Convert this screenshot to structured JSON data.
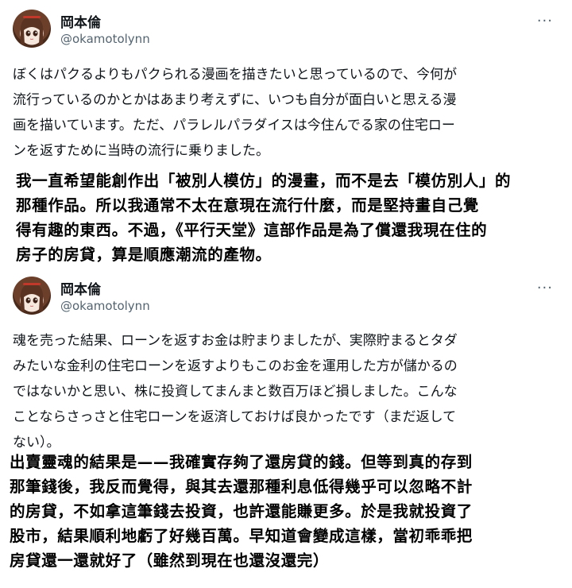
{
  "posts": [
    {
      "author": {
        "name": "岡本倫",
        "handle": "@okamotolynn"
      },
      "more_icon": "more-dots-icon",
      "text": "ぼくはパクるよりもパクられる漫画を描きたいと思っているので、今何が\n流行っているのかとかはあまり考えずに、いつも自分が面白いと思える漫\n画を描いています。ただ、パラレルパラダイスは今住んでる家の住宅ロー\nンを返すために当時の流行に乗りました。",
      "translation": "我一直希望能創作出「被別人模仿」的漫畫，而不是去「模仿別人」的\n那種作品。所以我通常不太在意現在流行什麼，而是堅持畫自己覺\n得有趣的東西。不過，《平行天堂》這部作品是為了償還我現在住的\n房子的房貸，算是順應潮流的產物。"
    },
    {
      "author": {
        "name": "岡本倫",
        "handle": "@okamotolynn"
      },
      "more_icon": "more-dots-icon",
      "text": "魂を売った結果、ローンを返すお金は貯まりましたが、実際貯まるとタダ\nみたいな金利の住宅ローンを返すよりもこのお金を運用した方が儲かるの\nではないかと思い、株に投資してまんまと数百万ほど損しました。こんな\nことならさっさと住宅ローンを返済しておけば良かったです（まだ返して\nない）。",
      "translation": "出賣靈魂的結果是——我確實存夠了還房貸的錢。但等到真的存到\n那筆錢後，我反而覺得，與其去還那種利息低得幾乎可以忽略不計\n的房貸，不如拿這筆錢去投資，也許還能賺更多。於是我就投資了\n股市，結果順利地虧了好幾百萬。早知道會變成這樣，當初乖乖把\n房貸還一還就好了（雖然到現在也還沒還完）"
    }
  ]
}
